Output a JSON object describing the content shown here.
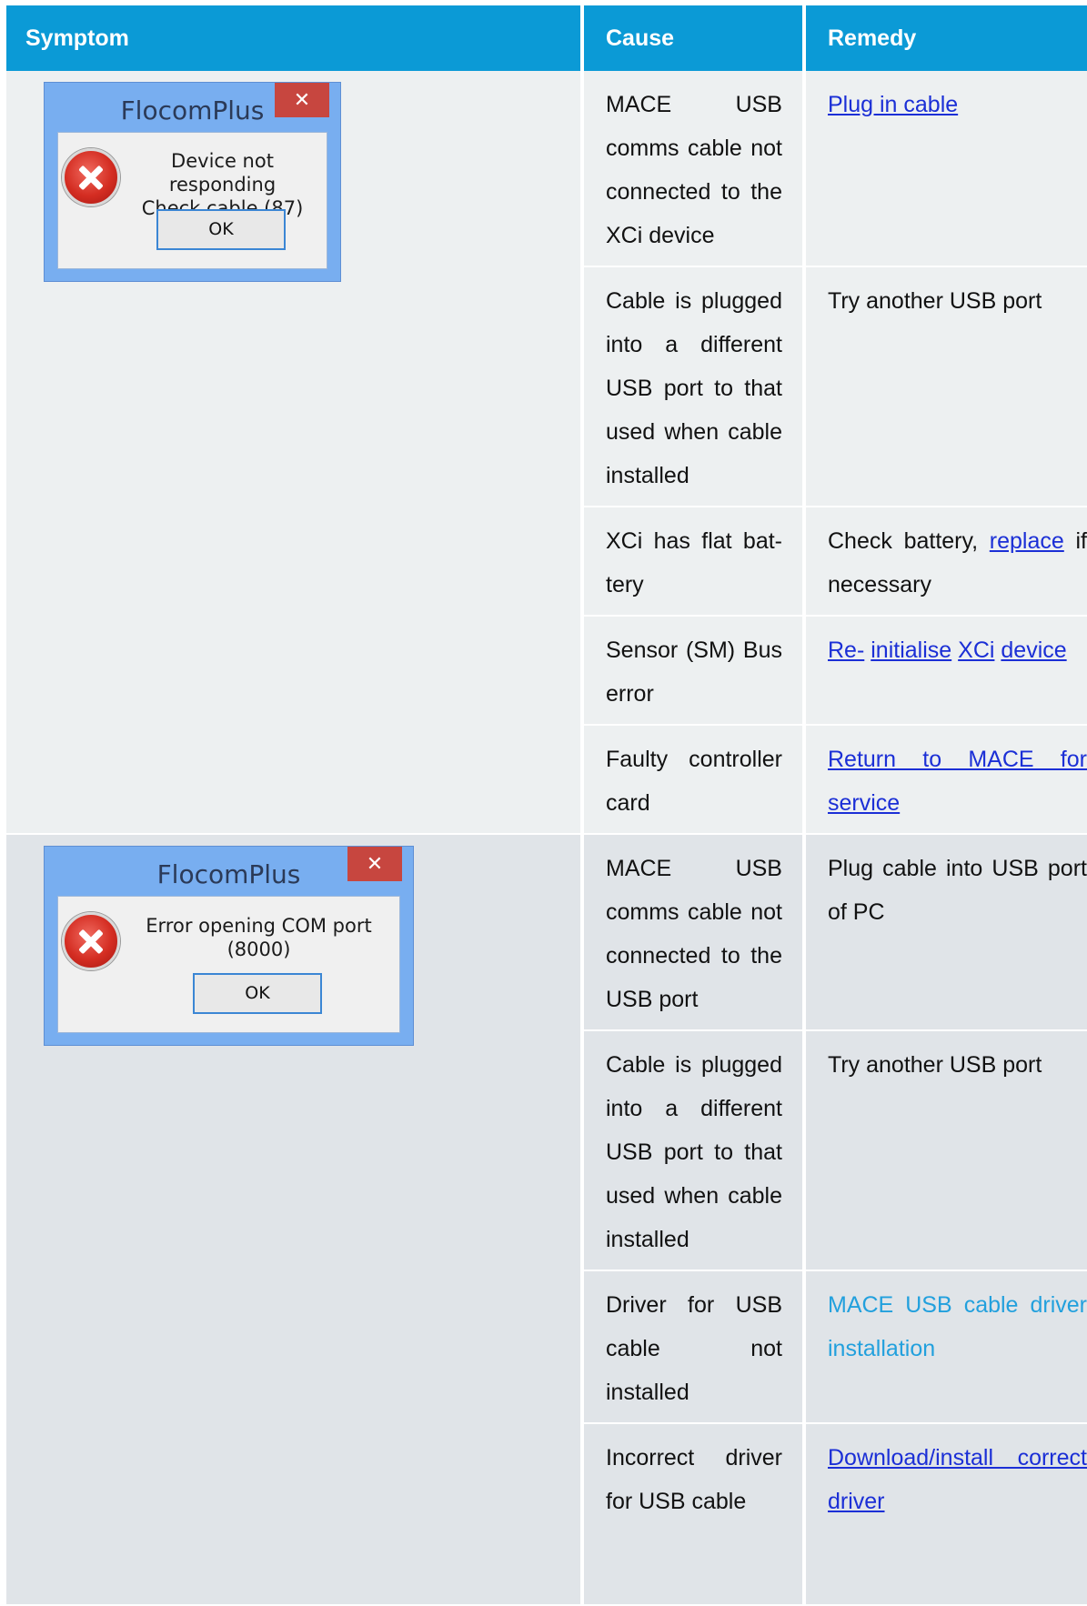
{
  "headers": {
    "symptom": "Symptom",
    "cause": "Cause",
    "remedy": "Remedy"
  },
  "dialogs": [
    {
      "title": "FlocomPlus",
      "close": "✕",
      "message_line1": "Device not responding",
      "message_line2": "Check cable (87)",
      "ok": "OK"
    },
    {
      "title": "FlocomPlus",
      "close": "✕",
      "message_line1": "Error opening COM port (8000)",
      "ok": "OK"
    }
  ],
  "group1": [
    {
      "cause": "MACE USB comms cable not connected to the XCi device",
      "remedy": "Plug in cable"
    },
    {
      "cause": "Cable is plugged into a different USB port to that used when cable installed",
      "remedy": "Try another USB port"
    },
    {
      "cause": "XCi has flat bat-tery",
      "remedy_text1": "Check battery, ",
      "remedy_link": "replace",
      "remedy_text2": " if necessary"
    },
    {
      "cause": "Sensor (SM) Bus error",
      "remedy_link1": "Re-",
      "remedy_link2": "initialise",
      "remedy_link3": "XCi",
      "remedy_link4": "device"
    },
    {
      "cause": "Faulty controller card",
      "remedy": "Return to MACE for service"
    }
  ],
  "group2": [
    {
      "cause": "MACE USB comms cable not connected to the USB port",
      "remedy": "Plug cable into USB port of PC"
    },
    {
      "cause": "Cable is plugged into a different USB port to that used when cable installed",
      "remedy": "Try another USB port"
    },
    {
      "cause": "Driver for USB cable not installed",
      "remedy": "MACE USB cable driver installation"
    },
    {
      "cause": "Incorrect driver for USB cable",
      "remedy": "Download/install correct driver"
    }
  ],
  "colors": {
    "header": "#0b9ad6",
    "row_light": "#edf0f1",
    "row_dark": "#e0e4e8",
    "link": "#1b2fd6",
    "link_light": "#22a0dd"
  }
}
